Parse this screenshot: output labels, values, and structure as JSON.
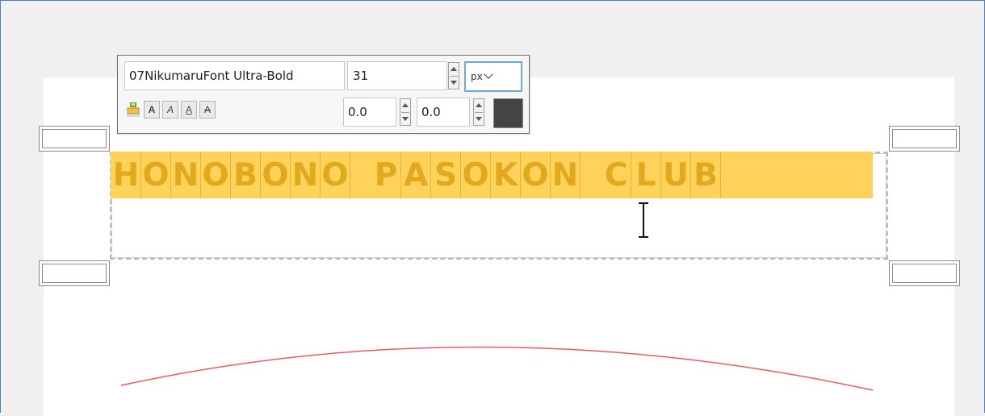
{
  "toolbar": {
    "font_name": "07NikumaruFont Ultra-Bold",
    "font_size": "31",
    "unit": "px",
    "offset_x": "0.0",
    "offset_y": "0.0",
    "text_color": "#444444",
    "style_buttons": [
      {
        "name": "text-color-fill-icon"
      },
      {
        "label": "A",
        "name": "bold-icon"
      },
      {
        "label": "A",
        "name": "italic-icon"
      },
      {
        "label": "A",
        "name": "underline-icon"
      },
      {
        "label": "A",
        "name": "strikethrough-icon"
      }
    ]
  },
  "canvas": {
    "text": "HONOBONO PASOKON CLUB",
    "selection_color": "#ffd35a",
    "glyph_color": "#e2a91e",
    "path_color": "#f05a5a"
  },
  "cursor": {
    "icon": "text-cursor-icon"
  }
}
